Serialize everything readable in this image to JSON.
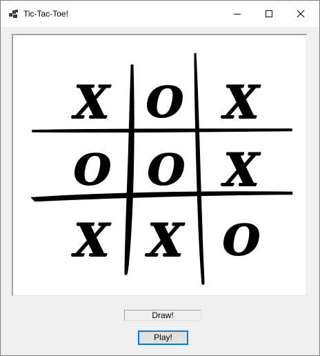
{
  "window": {
    "title": "Tic-Tac-Toe!",
    "icon": "app-icon",
    "controls": {
      "minimize_icon": "minimize-icon",
      "maximize_icon": "maximize-icon",
      "close_icon": "close-icon"
    }
  },
  "board": {
    "cells": [
      [
        "X",
        "O",
        "X"
      ],
      [
        "O",
        "O",
        "X"
      ],
      [
        "X",
        "X",
        "O"
      ]
    ]
  },
  "status": {
    "text": "Draw!"
  },
  "play_button": {
    "label": "Play!"
  }
}
